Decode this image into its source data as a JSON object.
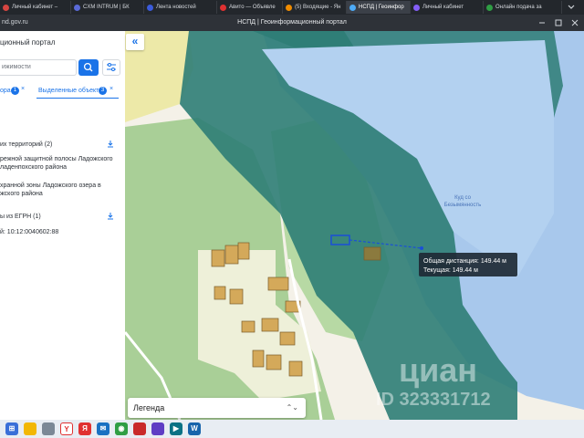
{
  "browser": {
    "tabs": [
      {
        "label": "Личный кабинет –",
        "color": "#d64541",
        "active": false
      },
      {
        "label": "CXM INTRUM | БК",
        "color": "#5a6ad8",
        "active": false
      },
      {
        "label": "Лента новостей",
        "color": "#3b5bdb",
        "active": false
      },
      {
        "label": "Авито — Объявле",
        "color": "#e03131",
        "active": false
      },
      {
        "label": "(5) Входящие - Ян",
        "color": "#f08c00",
        "active": false
      },
      {
        "label": "НСПД | Геоинфор",
        "color": "#4dabf7",
        "active": true
      },
      {
        "label": "Личный кабинет",
        "color": "#845ef7",
        "active": false
      },
      {
        "label": "Онлайн подача за",
        "color": "#2f9e44",
        "active": false
      }
    ],
    "url": "nd.gov.ru",
    "page_title": "НСПД | Геоинформационный портал"
  },
  "sidebar": {
    "portal_title": "ционный портал",
    "search_placeholder": "ижимости",
    "filter_left_label": "ора",
    "filter_left_count": "1",
    "filter_right_label": "Выделенные объекты",
    "filter_right_count": "3",
    "section1_title": "их территорий (2)",
    "section1_item1_line1": "режной защитной полосы Ладожского",
    "section1_item1_line2": "ладенпохского района",
    "section1_item2_line1": "хранной зоны Ладожского озера в",
    "section1_item2_line2": "жского района",
    "section2_title": "ы из ЕГРН (1)",
    "section2_item": "й: 10:12:0040602:88"
  },
  "map": {
    "collapse_glyph": "«",
    "lake_label_line1": "Куд со",
    "lake_label_line2": "Безымянность",
    "tooltip_line1": "Общая дистанция: 149.44 м",
    "tooltip_line2": "Текущая: 149.44 м",
    "watermark": "циан",
    "watermark_id": "ID 323331712",
    "colors": {
      "water": "#a8c8ec",
      "zone": "#2e7d76",
      "land": "#9fc690"
    }
  },
  "legend": {
    "label": "Легенда",
    "arrow": "⌃⌄"
  },
  "taskbar": {
    "icons": [
      "start-icon",
      "file-explorer-icon",
      "contacts-icon",
      "yandex-browser-icon",
      "yandex-icon",
      "mail-icon",
      "chrome-icon",
      "red-app-icon",
      "gallery-icon",
      "video-icon",
      "doc-icon"
    ]
  }
}
